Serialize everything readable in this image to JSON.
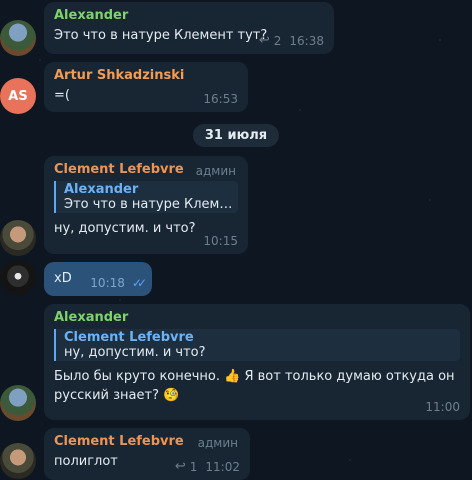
{
  "colors": {
    "alexander": "#7ed36a",
    "artur": "#f39c54",
    "clement": "#e8955a",
    "accent": "#5ea2f0"
  },
  "messages": [
    {
      "sender": "Alexander",
      "text": "Это что в натуре Клемент тут?",
      "reply_count": "2",
      "time": "16:38"
    },
    {
      "sender": "Artur Shkadzinski",
      "avatar_initials": "AS",
      "text": "=(",
      "time": "16:53"
    },
    {
      "sender": "Clement Lefebvre",
      "role": "админ",
      "quote_name": "Alexander",
      "quote_text": "Это что в натуре Клемент...",
      "text": "ну, допустим. и что?",
      "time": "10:15"
    },
    {
      "text": "xD",
      "time": "10:18"
    },
    {
      "sender": "Alexander",
      "quote_name": "Clement Lefebvre",
      "quote_text": "ну, допустим. и что?",
      "text_line1": "Было бы круто конечно. 👍 Я вот только думаю откуда он",
      "text_line2": "русский знает? 🧐",
      "time": "11:00"
    },
    {
      "sender": "Clement Lefebvre",
      "role": "админ",
      "text": "полиглот",
      "reply_count": "1",
      "time": "11:02"
    }
  ],
  "date_separator": "31 июля"
}
